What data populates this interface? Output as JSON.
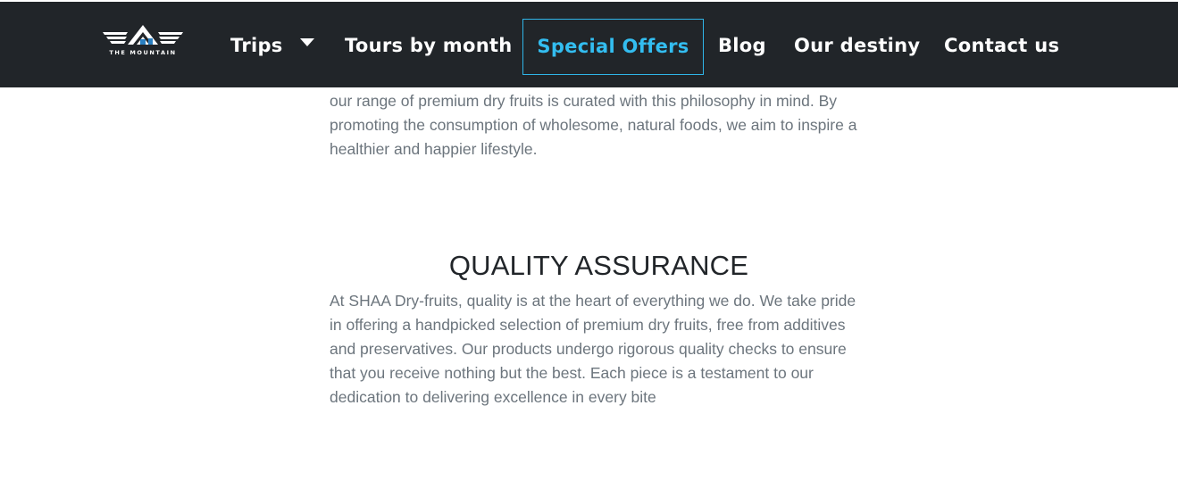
{
  "navbar": {
    "logo_text": "THE MOUNTAIN",
    "items": [
      {
        "label": "Trips",
        "has_dropdown": true
      },
      {
        "label": "Tours by month"
      },
      {
        "label": "Special Offers",
        "active": true
      },
      {
        "label": "Blog"
      },
      {
        "label": "Our destiny"
      },
      {
        "label": "Contact us"
      }
    ],
    "colors": {
      "background": "#212529",
      "text": "#ffffff",
      "active": "#33bdf0"
    }
  },
  "content": {
    "intro_paragraph": "our range of premium dry fruits is curated with this philosophy in mind. By promoting the consumption of wholesome, natural foods, we aim to inspire a healthier and happier lifestyle.",
    "quality": {
      "heading": "QUALITY ASSURANCE",
      "paragraph": "At SHAA Dry-fruits, quality is at the heart of everything we do. We take pride in offering a handpicked selection of premium dry fruits, free from additives and preservatives. Our products undergo rigorous quality checks to ensure that you receive nothing but the best. Each piece is a testament to our dedication to delivering excellence in every bite"
    }
  }
}
